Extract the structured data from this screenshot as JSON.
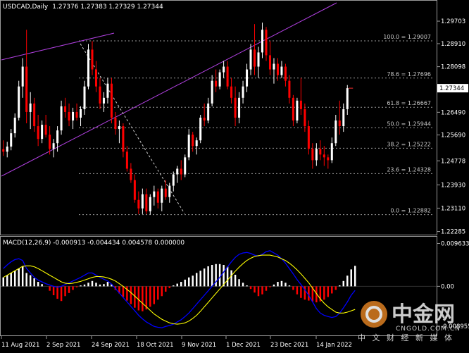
{
  "chart_data": [
    {
      "type": "candlestick",
      "title": "USDCAD,Daily",
      "ohlc_text": "1.27376 1.27383 1.27329 1.27344",
      "ylim": [
        1.2225,
        1.303
      ],
      "y_ticks": [
        "1.29703",
        "1.28910",
        "1.28098",
        "1.27344",
        "1.26490",
        "1.25690",
        "1.24778",
        "1.23930",
        "1.23110",
        "1.22285"
      ],
      "y_tick_values": [
        1.29703,
        1.2891,
        1.28098,
        1.27344,
        1.2649,
        1.2569,
        1.24778,
        1.2393,
        1.2311,
        1.22285
      ],
      "current_price_label": "1.27344",
      "x_ticks": [
        "11 Aug 2021",
        "2 Sep 2021",
        "24 Sep 2021",
        "18 Oct 2021",
        "9 Nov 2021",
        "1 Dec 2021",
        "23 Dec 2021",
        "14 Jan 2022"
      ],
      "bull_color": "#ffffff",
      "bear_color": "#ff0000",
      "trendline_color": "#b040e0",
      "fibonacci": [
        {
          "label": "100.0 = 1.29007",
          "value": 1.29007
        },
        {
          "label": "78.6 = 1.27696",
          "value": 1.27696
        },
        {
          "label": "61.8 = 1.26667",
          "value": 1.26667
        },
        {
          "label": "50.0 = 1.25944",
          "value": 1.25944
        },
        {
          "label": "38.2 = 1.25222",
          "value": 1.25222
        },
        {
          "label": "23.6 = 1.24328",
          "value": 1.24328
        },
        {
          "label": "0.0 = 1.22882",
          "value": 1.22882
        }
      ],
      "candles": [
        {
          "o": 1.2519,
          "h": 1.255,
          "l": 1.2495,
          "c": 1.251
        },
        {
          "o": 1.251,
          "h": 1.2545,
          "l": 1.249,
          "c": 1.2528
        },
        {
          "o": 1.2528,
          "h": 1.259,
          "l": 1.2515,
          "c": 1.2575
        },
        {
          "o": 1.2575,
          "h": 1.2645,
          "l": 1.256,
          "c": 1.263
        },
        {
          "o": 1.263,
          "h": 1.276,
          "l": 1.262,
          "c": 1.274
        },
        {
          "o": 1.274,
          "h": 1.284,
          "l": 1.27,
          "c": 1.281
        },
        {
          "o": 1.281,
          "h": 1.294,
          "l": 1.261,
          "c": 1.265
        },
        {
          "o": 1.265,
          "h": 1.272,
          "l": 1.259,
          "c": 1.268
        },
        {
          "o": 1.268,
          "h": 1.27,
          "l": 1.258,
          "c": 1.26
        },
        {
          "o": 1.26,
          "h": 1.264,
          "l": 1.253,
          "c": 1.2555
        },
        {
          "o": 1.2555,
          "h": 1.262,
          "l": 1.254,
          "c": 1.2605
        },
        {
          "o": 1.2605,
          "h": 1.264,
          "l": 1.256,
          "c": 1.257
        },
        {
          "o": 1.257,
          "h": 1.26,
          "l": 1.25,
          "c": 1.252
        },
        {
          "o": 1.252,
          "h": 1.2555,
          "l": 1.249,
          "c": 1.254
        },
        {
          "o": 1.254,
          "h": 1.26,
          "l": 1.251,
          "c": 1.2585
        },
        {
          "o": 1.2585,
          "h": 1.269,
          "l": 1.257,
          "c": 1.267
        },
        {
          "o": 1.267,
          "h": 1.27,
          "l": 1.263,
          "c": 1.265
        },
        {
          "o": 1.265,
          "h": 1.268,
          "l": 1.26,
          "c": 1.262
        },
        {
          "o": 1.262,
          "h": 1.2665,
          "l": 1.259,
          "c": 1.265
        },
        {
          "o": 1.265,
          "h": 1.268,
          "l": 1.262,
          "c": 1.263
        },
        {
          "o": 1.263,
          "h": 1.267,
          "l": 1.26,
          "c": 1.266
        },
        {
          "o": 1.266,
          "h": 1.276,
          "l": 1.264,
          "c": 1.274
        },
        {
          "o": 1.274,
          "h": 1.289,
          "l": 1.273,
          "c": 1.287
        },
        {
          "o": 1.287,
          "h": 1.29,
          "l": 1.278,
          "c": 1.28
        },
        {
          "o": 1.28,
          "h": 1.283,
          "l": 1.272,
          "c": 1.274
        },
        {
          "o": 1.274,
          "h": 1.277,
          "l": 1.266,
          "c": 1.268
        },
        {
          "o": 1.268,
          "h": 1.272,
          "l": 1.265,
          "c": 1.27
        },
        {
          "o": 1.27,
          "h": 1.277,
          "l": 1.268,
          "c": 1.275
        },
        {
          "o": 1.275,
          "h": 1.277,
          "l": 1.261,
          "c": 1.263
        },
        {
          "o": 1.263,
          "h": 1.265,
          "l": 1.257,
          "c": 1.259
        },
        {
          "o": 1.259,
          "h": 1.262,
          "l": 1.254,
          "c": 1.26
        },
        {
          "o": 1.26,
          "h": 1.261,
          "l": 1.249,
          "c": 1.251
        },
        {
          "o": 1.251,
          "h": 1.253,
          "l": 1.244,
          "c": 1.245
        },
        {
          "o": 1.245,
          "h": 1.247,
          "l": 1.24,
          "c": 1.241
        },
        {
          "o": 1.241,
          "h": 1.243,
          "l": 1.233,
          "c": 1.234
        },
        {
          "o": 1.234,
          "h": 1.237,
          "l": 1.229,
          "c": 1.231
        },
        {
          "o": 1.231,
          "h": 1.238,
          "l": 1.229,
          "c": 1.236
        },
        {
          "o": 1.236,
          "h": 1.238,
          "l": 1.229,
          "c": 1.23
        },
        {
          "o": 1.23,
          "h": 1.236,
          "l": 1.2288,
          "c": 1.235
        },
        {
          "o": 1.235,
          "h": 1.239,
          "l": 1.232,
          "c": 1.237
        },
        {
          "o": 1.237,
          "h": 1.238,
          "l": 1.231,
          "c": 1.233
        },
        {
          "o": 1.233,
          "h": 1.239,
          "l": 1.23,
          "c": 1.238
        },
        {
          "o": 1.238,
          "h": 1.241,
          "l": 1.234,
          "c": 1.235
        },
        {
          "o": 1.235,
          "h": 1.24,
          "l": 1.233,
          "c": 1.239
        },
        {
          "o": 1.239,
          "h": 1.244,
          "l": 1.237,
          "c": 1.243
        },
        {
          "o": 1.243,
          "h": 1.246,
          "l": 1.24,
          "c": 1.245
        },
        {
          "o": 1.245,
          "h": 1.248,
          "l": 1.241,
          "c": 1.243
        },
        {
          "o": 1.243,
          "h": 1.25,
          "l": 1.242,
          "c": 1.249
        },
        {
          "o": 1.249,
          "h": 1.259,
          "l": 1.248,
          "c": 1.257
        },
        {
          "o": 1.257,
          "h": 1.258,
          "l": 1.251,
          "c": 1.253
        },
        {
          "o": 1.253,
          "h": 1.256,
          "l": 1.25,
          "c": 1.255
        },
        {
          "o": 1.255,
          "h": 1.264,
          "l": 1.254,
          "c": 1.263
        },
        {
          "o": 1.263,
          "h": 1.268,
          "l": 1.26,
          "c": 1.262
        },
        {
          "o": 1.262,
          "h": 1.27,
          "l": 1.261,
          "c": 1.268
        },
        {
          "o": 1.268,
          "h": 1.278,
          "l": 1.267,
          "c": 1.276
        },
        {
          "o": 1.276,
          "h": 1.28,
          "l": 1.272,
          "c": 1.274
        },
        {
          "o": 1.274,
          "h": 1.28,
          "l": 1.273,
          "c": 1.279
        },
        {
          "o": 1.279,
          "h": 1.283,
          "l": 1.277,
          "c": 1.281
        },
        {
          "o": 1.281,
          "h": 1.283,
          "l": 1.273,
          "c": 1.274
        },
        {
          "o": 1.274,
          "h": 1.277,
          "l": 1.268,
          "c": 1.27
        },
        {
          "o": 1.27,
          "h": 1.274,
          "l": 1.26,
          "c": 1.263
        },
        {
          "o": 1.263,
          "h": 1.272,
          "l": 1.261,
          "c": 1.27
        },
        {
          "o": 1.27,
          "h": 1.276,
          "l": 1.268,
          "c": 1.274
        },
        {
          "o": 1.274,
          "h": 1.282,
          "l": 1.272,
          "c": 1.28
        },
        {
          "o": 1.28,
          "h": 1.289,
          "l": 1.278,
          "c": 1.287
        },
        {
          "o": 1.287,
          "h": 1.296,
          "l": 1.278,
          "c": 1.281
        },
        {
          "o": 1.281,
          "h": 1.288,
          "l": 1.277,
          "c": 1.286
        },
        {
          "o": 1.286,
          "h": 1.2965,
          "l": 1.284,
          "c": 1.294
        },
        {
          "o": 1.294,
          "h": 1.295,
          "l": 1.283,
          "c": 1.285
        },
        {
          "o": 1.285,
          "h": 1.29,
          "l": 1.278,
          "c": 1.28
        },
        {
          "o": 1.28,
          "h": 1.284,
          "l": 1.275,
          "c": 1.282
        },
        {
          "o": 1.282,
          "h": 1.284,
          "l": 1.276,
          "c": 1.278
        },
        {
          "o": 1.278,
          "h": 1.283,
          "l": 1.277,
          "c": 1.281
        },
        {
          "o": 1.281,
          "h": 1.282,
          "l": 1.274,
          "c": 1.276
        },
        {
          "o": 1.276,
          "h": 1.278,
          "l": 1.268,
          "c": 1.27
        },
        {
          "o": 1.27,
          "h": 1.271,
          "l": 1.26,
          "c": 1.262
        },
        {
          "o": 1.262,
          "h": 1.27,
          "l": 1.261,
          "c": 1.269
        },
        {
          "o": 1.269,
          "h": 1.277,
          "l": 1.264,
          "c": 1.266
        },
        {
          "o": 1.266,
          "h": 1.268,
          "l": 1.258,
          "c": 1.26
        },
        {
          "o": 1.26,
          "h": 1.262,
          "l": 1.25,
          "c": 1.252
        },
        {
          "o": 1.252,
          "h": 1.254,
          "l": 1.245,
          "c": 1.248
        },
        {
          "o": 1.248,
          "h": 1.254,
          "l": 1.246,
          "c": 1.252
        },
        {
          "o": 1.252,
          "h": 1.255,
          "l": 1.248,
          "c": 1.25
        },
        {
          "o": 1.25,
          "h": 1.253,
          "l": 1.246,
          "c": 1.249
        },
        {
          "o": 1.249,
          "h": 1.25,
          "l": 1.245,
          "c": 1.248
        },
        {
          "o": 1.248,
          "h": 1.256,
          "l": 1.247,
          "c": 1.254
        },
        {
          "o": 1.254,
          "h": 1.264,
          "l": 1.253,
          "c": 1.262
        },
        {
          "o": 1.262,
          "h": 1.269,
          "l": 1.257,
          "c": 1.26
        },
        {
          "o": 1.26,
          "h": 1.268,
          "l": 1.258,
          "c": 1.266
        },
        {
          "o": 1.266,
          "h": 1.2745,
          "l": 1.264,
          "c": 1.2734
        }
      ]
    },
    {
      "type": "macd",
      "title": "MACD(12,26,9) -0.000913 -0.004434 0.004578 0.000000",
      "ylim": [
        -0.0107,
        0.0105
      ],
      "y_ticks": [
        "0.009633",
        "0.00",
        "-0.008955"
      ],
      "y_tick_values": [
        0.009633,
        0.0,
        -0.008955
      ],
      "hist_pos_color": "#ffffff",
      "hist_neg_color": "#ff0000",
      "macd_line_color": "#0000ff",
      "signal_line_color": "#ffff00",
      "histogram": [
        0.002,
        0.0025,
        0.003,
        0.0035,
        0.004,
        0.0045,
        0.003,
        0.0025,
        0.0018,
        0.001,
        0.0005,
        0.0,
        -0.001,
        -0.002,
        -0.0028,
        -0.0033,
        -0.0022,
        -0.0015,
        -0.0008,
        -0.0002,
        0.0002,
        0.0004,
        0.0008,
        0.0012,
        0.0008,
        0.0004,
        0.0005,
        0.001,
        0.0005,
        -0.0008,
        -0.0016,
        -0.0024,
        -0.0032,
        -0.004,
        -0.0048,
        -0.0054,
        -0.0056,
        -0.0052,
        -0.0046,
        -0.004,
        -0.003,
        -0.0022,
        -0.0012,
        -0.0004,
        0.0002,
        0.0006,
        0.001,
        0.0015,
        0.002,
        0.0024,
        0.003,
        0.0035,
        0.004,
        0.0045,
        0.0048,
        0.005,
        0.005,
        0.0048,
        0.0044,
        0.0036,
        0.0026,
        0.0016,
        0.0008,
        0.0002,
        -0.0006,
        -0.0014,
        -0.0022,
        -0.0018,
        -0.001,
        -0.0002,
        0.0004,
        0.001,
        0.0012,
        0.0008,
        0.0002,
        -0.0008,
        -0.0018,
        -0.0026,
        -0.003,
        -0.0032,
        -0.0034,
        -0.0036,
        -0.0034,
        -0.003,
        -0.0024,
        -0.0016,
        -0.0008,
        0.0002,
        0.0012,
        0.0024,
        0.0038,
        0.0046
      ],
      "macd_line": [
        0.004,
        0.0048,
        0.0055,
        0.006,
        0.0062,
        0.0058,
        0.004,
        0.003,
        0.002,
        0.0014,
        0.001,
        0.0006,
        0.0003,
        0.0,
        -0.0002,
        0.0,
        0.0004,
        0.0008,
        0.0012,
        0.0016,
        0.002,
        0.0025,
        0.003,
        0.003,
        0.0025,
        0.002,
        0.0016,
        0.0012,
        0.0005,
        -0.0005,
        -0.0015,
        -0.0025,
        -0.0035,
        -0.0045,
        -0.0055,
        -0.0065,
        -0.0073,
        -0.008,
        -0.0085,
        -0.009,
        -0.0092,
        -0.0093,
        -0.009,
        -0.0088,
        -0.0085,
        -0.008,
        -0.0075,
        -0.0068,
        -0.006,
        -0.005,
        -0.004,
        -0.003,
        -0.002,
        -0.001,
        0.0,
        0.001,
        0.002,
        0.0032,
        0.0044,
        0.0055,
        0.0065,
        0.0072,
        0.0075,
        0.0076,
        0.0074,
        0.007,
        0.0068,
        0.0072,
        0.0078,
        0.008,
        0.0075,
        0.007,
        0.0062,
        0.0052,
        0.004,
        0.0028,
        0.0015,
        0.0004,
        -0.0008,
        -0.002,
        -0.0035,
        -0.005,
        -0.006,
        -0.0065,
        -0.0068,
        -0.007,
        -0.0068,
        -0.006,
        -0.0048,
        -0.0035,
        -0.002,
        -0.0009
      ],
      "signal_line": [
        0.002,
        0.0025,
        0.003,
        0.0035,
        0.004,
        0.0045,
        0.0046,
        0.0046,
        0.0044,
        0.004,
        0.0035,
        0.003,
        0.0025,
        0.002,
        0.0015,
        0.001,
        0.0007,
        0.0006,
        0.0007,
        0.0009,
        0.0011,
        0.0014,
        0.0017,
        0.002,
        0.0022,
        0.0022,
        0.0021,
        0.0019,
        0.0016,
        0.0012,
        0.0006,
        0.0,
        -0.0007,
        -0.0014,
        -0.0022,
        -0.003,
        -0.0038,
        -0.0046,
        -0.0054,
        -0.0062,
        -0.0068,
        -0.0074,
        -0.0078,
        -0.0082,
        -0.0084,
        -0.0085,
        -0.0084,
        -0.0082,
        -0.0078,
        -0.0072,
        -0.0065,
        -0.0056,
        -0.0046,
        -0.0036,
        -0.0026,
        -0.0016,
        -0.0006,
        0.0004,
        0.0014,
        0.0024,
        0.0034,
        0.0043,
        0.0051,
        0.0058,
        0.0063,
        0.0067,
        0.0069,
        0.007,
        0.007,
        0.007,
        0.0068,
        0.0066,
        0.0062,
        0.0058,
        0.0052,
        0.0045,
        0.0037,
        0.0028,
        0.0018,
        0.0008,
        -0.0004,
        -0.0016,
        -0.0028,
        -0.0038,
        -0.0046,
        -0.0052,
        -0.0058,
        -0.006,
        -0.006,
        -0.0058,
        -0.0055,
        -0.0052
      ]
    }
  ],
  "watermark": {
    "brand": "中金网",
    "site": "CNGOLD.COM.CN",
    "tagline": "中 文 财 经 新 媒 体"
  }
}
